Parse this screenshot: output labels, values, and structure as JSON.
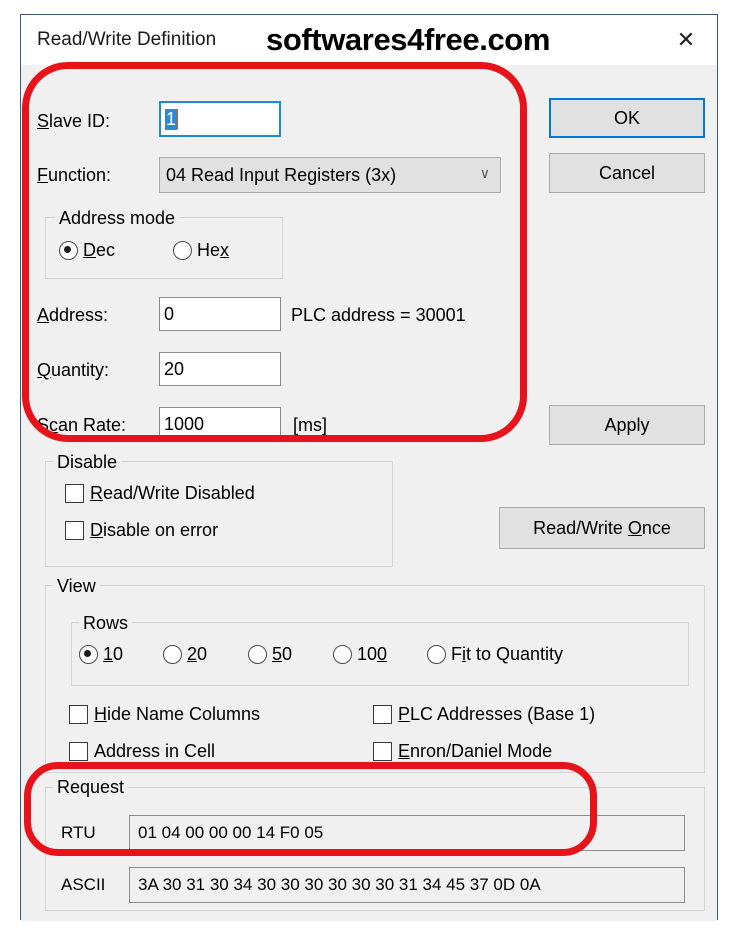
{
  "window": {
    "title": "Read/Write Definition",
    "watermark": "softwares4free.com",
    "close_label": "✕"
  },
  "form": {
    "slave_id": {
      "label": "Slave ID:",
      "mnemonic": "S",
      "value": "1",
      "selected": true
    },
    "function": {
      "label": "Function:",
      "mnemonic": "F",
      "value": "04 Read Input Registers (3x)",
      "arrow": "∨"
    },
    "address_mode": {
      "group_title": "Address mode",
      "options": [
        {
          "label": "Dec",
          "mnemonic": "D",
          "selected": true
        },
        {
          "label": "Hex",
          "mnemonic": "x",
          "selected": false
        }
      ]
    },
    "address": {
      "label": "Address:",
      "mnemonic": "A",
      "value": "0",
      "hint": "PLC address = 30001"
    },
    "quantity": {
      "label": "Quantity:",
      "mnemonic": "Q",
      "value": "20"
    },
    "scan_rate": {
      "label": "Scan Rate:",
      "mnemonic": "c",
      "value": "1000",
      "unit": "[ms]"
    }
  },
  "disable": {
    "group_title": "Disable",
    "checkboxes": [
      {
        "label": "Read/Write Disabled",
        "checked": false
      },
      {
        "label": "Disable on error",
        "checked": false
      }
    ]
  },
  "view": {
    "group_title": "View",
    "rows_title": "Rows",
    "rows_options": [
      {
        "label": "10",
        "selected": true
      },
      {
        "label": "20",
        "selected": false
      },
      {
        "label": "50",
        "selected": false
      },
      {
        "label": "100",
        "selected": false
      },
      {
        "label": "Fit to Quantity",
        "selected": false
      }
    ],
    "checkboxes": [
      {
        "label": "Hide Name Columns",
        "checked": false
      },
      {
        "label": "PLC Addresses (Base 1)",
        "checked": false
      },
      {
        "label": "Address in Cell",
        "checked": false
      },
      {
        "label": "Enron/Daniel Mode",
        "checked": false
      }
    ]
  },
  "request": {
    "group_title": "Request",
    "rtu_label": "RTU",
    "rtu_value": "01 04 00 00 00 14 F0 05",
    "ascii_label": "ASCII",
    "ascii_value": "3A 30 31 30 34 30 30 30 30 30 30 31 34 45 37 0D 0A"
  },
  "buttons": {
    "ok": "OK",
    "cancel": "Cancel",
    "apply": "Apply",
    "read_write_once": "Read/Write Once"
  },
  "colors": {
    "accent": "#0078d7",
    "annotation": "#e8121a",
    "selection": "#2b8ad8",
    "dialog_bg": "#f0f0f0"
  }
}
